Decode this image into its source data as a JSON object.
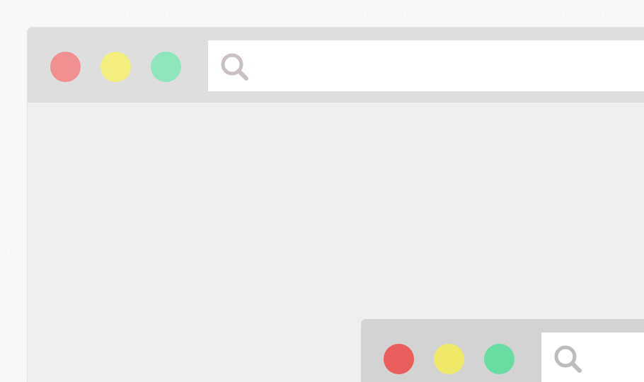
{
  "windows": [
    {
      "name": "back-window",
      "controls": {
        "close_color": "#f09090",
        "minimize_color": "#f2ef7e",
        "maximize_color": "#8fe6bd"
      },
      "search_icon": "search-icon",
      "search_icon_color": "#c9c0c0",
      "address_value": ""
    },
    {
      "name": "front-window",
      "controls": {
        "close_color": "#ea5d5d",
        "minimize_color": "#efe96a",
        "maximize_color": "#68dca2"
      },
      "search_icon": "search-icon",
      "search_icon_color": "#bdbdbd",
      "address_value": ""
    }
  ]
}
